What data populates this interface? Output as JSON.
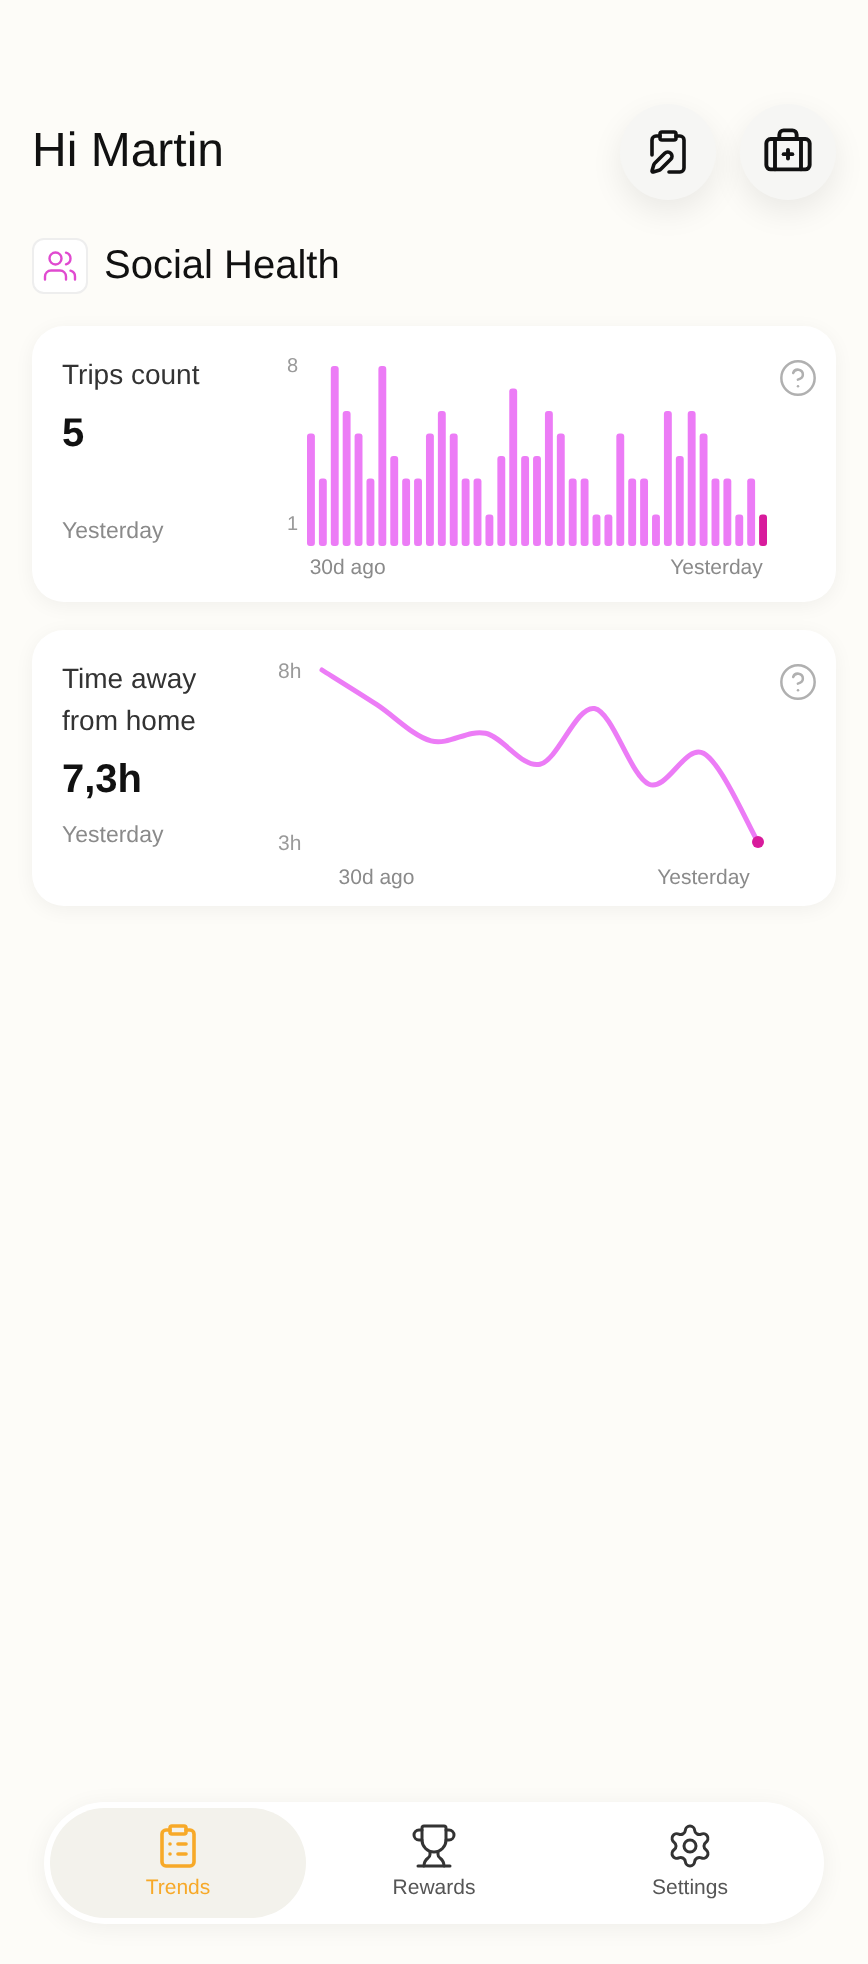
{
  "header": {
    "greeting": "Hi Martin"
  },
  "section": {
    "title": "Social Health"
  },
  "cards": [
    {
      "title": "Trips count",
      "value": "5",
      "period": "Yesterday",
      "chart_data": {
        "type": "bar",
        "categories": [
          null,
          null,
          null,
          "30d ago",
          null,
          null,
          null,
          null,
          null,
          null,
          null,
          null,
          null,
          null,
          null,
          null,
          null,
          null,
          null,
          null,
          null,
          null,
          null,
          null,
          null,
          null,
          null,
          null,
          null,
          null,
          null,
          null,
          null,
          null,
          "Yesterday",
          null,
          null,
          null,
          null
        ],
        "ylim": [
          0,
          8
        ],
        "yticks": [
          {
            "value": 8,
            "label": "8"
          },
          {
            "value": 1,
            "label": "1"
          }
        ],
        "series": [
          {
            "color": "#ec7cf6",
            "values": [
              5,
              3,
              8,
              6,
              5,
              3,
              8,
              4,
              3,
              3,
              5,
              6,
              5,
              3,
              3,
              1.4,
              4,
              7,
              4,
              4,
              6,
              5,
              3,
              3,
              1.4,
              1.4,
              5,
              3,
              3,
              1.4,
              6,
              4,
              6,
              5,
              3,
              3,
              1.4,
              3,
              null
            ]
          },
          {
            "color": "#d81b9c",
            "values": [
              null,
              null,
              null,
              null,
              null,
              null,
              null,
              null,
              null,
              null,
              null,
              null,
              null,
              null,
              null,
              null,
              null,
              null,
              null,
              null,
              null,
              null,
              null,
              null,
              null,
              null,
              null,
              null,
              null,
              null,
              null,
              null,
              null,
              null,
              null,
              null,
              null,
              null,
              1.4
            ]
          }
        ]
      }
    },
    {
      "title": "Time away from home",
      "value": "7,3h",
      "period": "Yesterday",
      "latest": {
        "color": "#d81b9c"
      },
      "chart_data": {
        "type": "line",
        "categories": [
          null,
          "30d ago",
          null,
          null,
          null,
          null,
          null,
          "Yesterday",
          null
        ],
        "ylim": [
          3,
          8
        ],
        "yticks": [
          {
            "value": 8,
            "label": "8h"
          },
          {
            "value": 3,
            "label": "3h"
          }
        ],
        "series": [
          {
            "color": "#ec7cf6",
            "values": [
              8,
              7.0,
              5.94,
              6.16,
              5.26,
              6.88,
              4.68,
              5.58,
              3
            ]
          }
        ]
      }
    }
  ],
  "nav": [
    {
      "kind": "trends",
      "label": "Trends",
      "selected": true
    },
    {
      "kind": "rewards",
      "label": "Rewards",
      "selected": false
    },
    {
      "kind": "settings",
      "label": "Settings",
      "selected": false
    }
  ]
}
